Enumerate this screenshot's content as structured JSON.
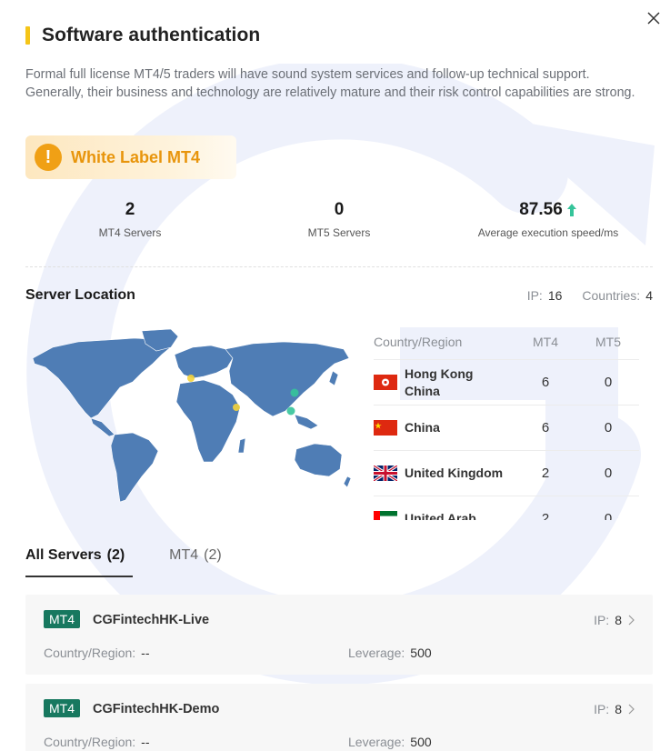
{
  "header": {
    "title": "Software authentication"
  },
  "description": "Formal full license MT4/5 traders will have sound system services and follow-up technical support. Generally, their business and technology are relatively mature and their risk control capabilities are strong.",
  "badge": {
    "label": "White Label MT4",
    "icon": "!"
  },
  "stats": [
    {
      "value": "2",
      "caption": "MT4 Servers"
    },
    {
      "value": "0",
      "caption": "MT5 Servers"
    },
    {
      "value": "87.56",
      "caption": "Average execution speed/ms"
    }
  ],
  "location": {
    "title": "Server Location",
    "ip_label": "IP:",
    "ip_value": "16",
    "countries_label": "Countries:",
    "countries_value": "4",
    "columns": {
      "country": "Country/Region",
      "mt4": "MT4",
      "mt5": "MT5"
    },
    "rows": [
      {
        "country_line1": "Hong Kong",
        "country_line2": "China",
        "mt4": "6",
        "mt5": "0",
        "flag": "hong-kong"
      },
      {
        "country_line1": "China",
        "country_line2": "",
        "mt4": "6",
        "mt5": "0",
        "flag": "china"
      },
      {
        "country_line1": "United Kingdom",
        "country_line2": "",
        "mt4": "2",
        "mt5": "0",
        "flag": "united-kingdom"
      },
      {
        "country_line1": "United Arab",
        "country_line2": "",
        "mt4": "2",
        "mt5": "0",
        "flag": "uae"
      }
    ]
  },
  "tabs": [
    {
      "label": "All Servers",
      "count": "(2)",
      "active": true
    },
    {
      "label": "MT4",
      "count": "(2)",
      "active": false
    }
  ],
  "servers": [
    {
      "tag": "MT4",
      "name": "CGFintechHK-Live",
      "ip_label": "IP:",
      "ip_value": "8",
      "region_label": "Country/Region:",
      "region_value": "--",
      "leverage_label": "Leverage:",
      "leverage_value": "500"
    },
    {
      "tag": "MT4",
      "name": "CGFintechHK-Demo",
      "ip_label": "IP:",
      "ip_value": "8",
      "region_label": "Country/Region:",
      "region_value": "--",
      "leverage_label": "Leverage:",
      "leverage_value": "500"
    }
  ],
  "colors": {
    "accent_yellow": "#f5c518",
    "badge_orange": "#e8950c",
    "mt4_tag": "#17785f",
    "map_land": "#4f7db5",
    "up_arrow": "#35c49a"
  }
}
